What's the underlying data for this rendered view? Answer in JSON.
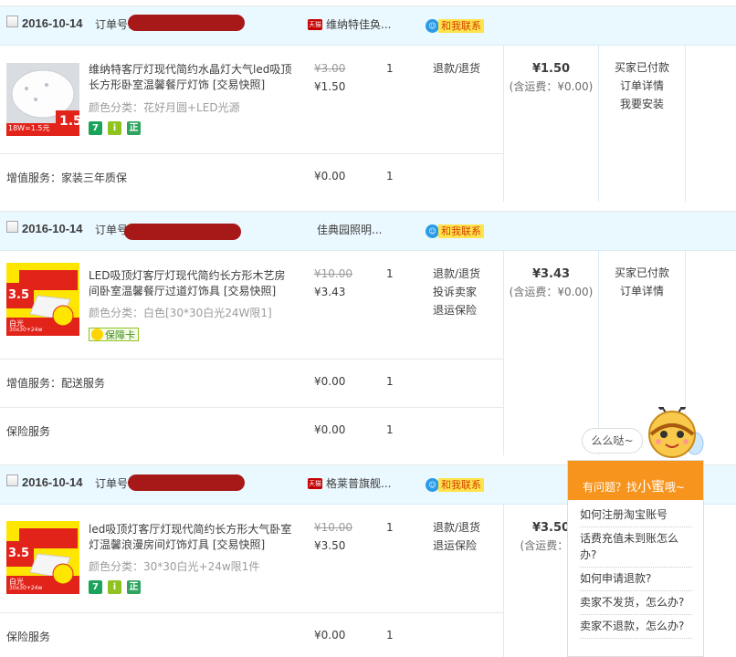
{
  "orders": [
    {
      "date": "2016-10-14",
      "order_label": "订单号:",
      "shop": "维纳特佳奂...",
      "tmall": true,
      "contact": "和我联系",
      "item": {
        "title": "维纳特客厅灯现代简约水晶灯大气led吸顶长方形卧室温馨餐厅灯饰 [交易快照]",
        "sku": "颜色分类：花好月圆+LED光源",
        "orig_price": "¥3.00",
        "price": "¥1.50",
        "qty": "1",
        "actions": [
          "退款/退货"
        ],
        "badges": [
          "7",
          "i",
          "正"
        ],
        "thumb_text": [
          "18W=1.5元",
          "1.5"
        ]
      },
      "total": "¥1.50",
      "shipping": "(含运费：¥0.00)",
      "status": [
        "买家已付款",
        "订单详情",
        "我要安装"
      ],
      "services": [
        {
          "label": "增值服务：家装三年质保",
          "price": "¥0.00",
          "qty": "1"
        }
      ]
    },
    {
      "date": "2016-10-14",
      "order_label": "订单号",
      "shop": "佳典园照明...",
      "tmall": false,
      "contact": "和我联系",
      "item": {
        "title": "LED吸顶灯客厅灯现代简约长方形木艺房间卧室温馨餐厅过道灯饰具 [交易快照]",
        "sku": "颜色分类：白色[30*30白光24W限1]",
        "orig_price": "¥10.00",
        "price": "¥3.43",
        "qty": "1",
        "actions": [
          "退款/退货",
          "投诉卖家",
          "退运保险"
        ],
        "guarantee": "保障卡",
        "thumb_text": [
          "3.5",
          "白光",
          "30x30+24w"
        ]
      },
      "total": "¥3.43",
      "shipping": "(含运费：¥0.00)",
      "status": [
        "买家已付款",
        "订单详情"
      ],
      "services": [
        {
          "label": "增值服务：配送服务",
          "price": "¥0.00",
          "qty": "1"
        },
        {
          "label": "保险服务",
          "price": "¥0.00",
          "qty": "1"
        }
      ]
    },
    {
      "date": "2016-10-14",
      "order_label": "订单号:",
      "shop": "格莱普旗舰...",
      "tmall": true,
      "contact": "和我联系",
      "item": {
        "title": "led吸顶灯客厅灯现代简约长方形大气卧室灯温馨浪漫房间灯饰灯具 [交易快照]",
        "sku": "颜色分类：30*30白光+24w限1件",
        "orig_price": "¥10.00",
        "price": "¥3.50",
        "qty": "1",
        "actions": [
          "退款/退货",
          "退运保险"
        ],
        "badges": [
          "7",
          "i",
          "正"
        ],
        "thumb_text": [
          "3.5",
          "白光",
          "30x30+24w"
        ]
      },
      "total": "¥3.50",
      "shipping": "(含运费：¥0",
      "status": [],
      "services": [
        {
          "label": "保险服务",
          "price": "¥0.00",
          "qty": "1"
        }
      ]
    }
  ],
  "help": {
    "bubble": "么么哒~",
    "title_prefix": "有问题？找",
    "title_name": "小蜜",
    "title_suffix": "哦~",
    "items": [
      "如何注册淘宝账号",
      "话费充值未到账怎么办?",
      "如何申请退款?",
      "卖家不发货，怎么办?",
      "卖家不退款，怎么办?"
    ]
  },
  "colors": {
    "header_bg": "#eaf8ff",
    "accent": "#f7941d",
    "redact": "#a30d0d"
  }
}
